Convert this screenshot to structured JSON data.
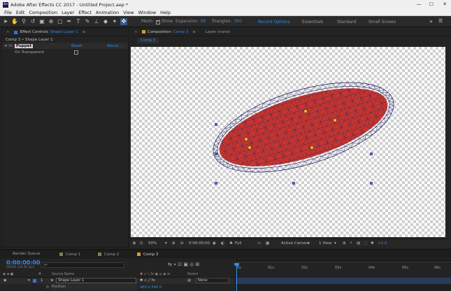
{
  "window": {
    "title": "Adobe After Effects CC 2017 - Untitled Project.aep *",
    "logo": "Ae"
  },
  "menu": [
    "File",
    "Edit",
    "Composition",
    "Layer",
    "Effect",
    "Animation",
    "View",
    "Window",
    "Help"
  ],
  "toolbar": {
    "mesh_label": "Mesh:",
    "show_label": "Show",
    "expansion_label": "Expansion:",
    "expansion_value": "65",
    "triangles_label": "Triangles:",
    "triangles_value": "350",
    "record_options": "Record Options",
    "workspaces": [
      "Essentials",
      "Standard",
      "Small Screen"
    ],
    "active_workspace": "Record Options"
  },
  "effect_controls": {
    "tab_prefix": "Effect Controls",
    "tab_layer": "Shape Layer 1",
    "subtitle": "Comp 3 • Shape Layer 1",
    "effect_name": "Puppet",
    "reset": "Reset",
    "about": "About...",
    "option_label": "On Transparent",
    "option_checked": false
  },
  "composition": {
    "tab_prefix": "Composition",
    "tab_name": "Comp 3",
    "layer_tab": "Layer (none)",
    "subtab": "Comp 3"
  },
  "viewer_bar": {
    "zoom": "50%",
    "timecode": "0:00:00:00",
    "resolution": "Full",
    "camera": "Active Camera",
    "views": "1 View",
    "exposure": "+0.0"
  },
  "timeline": {
    "tabs": [
      "Render Queue",
      "Comp 1",
      "Comp 2",
      "Comp 3"
    ],
    "active_tab": "Comp 3",
    "timecode": "0:00:00:00",
    "fps": "00000 (30.00 fps)",
    "search_placeholder": "ρ▾",
    "columns": [
      "#",
      "Source Name",
      "Parent"
    ],
    "layer": {
      "number": "1",
      "name": "Shape Layer 1",
      "parent": "None"
    },
    "property": {
      "name": "Position",
      "value": "960.0,540.0"
    },
    "ruler_labels": [
      "0s",
      "01s",
      "02s",
      "03s",
      "04s",
      "05s",
      "06s"
    ]
  },
  "colors": {
    "accent": "#2d8ceb",
    "shape_fill": "#c9342b",
    "mesh": "#2c2e6e",
    "comp_tab": "#d29b2f"
  }
}
